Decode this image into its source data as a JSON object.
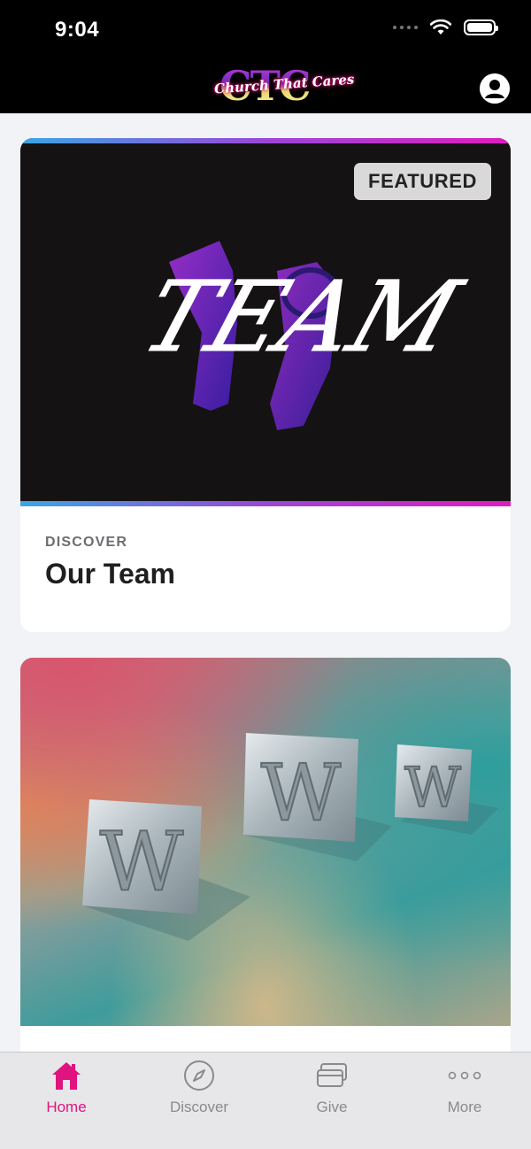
{
  "status_bar": {
    "time": "9:04"
  },
  "header": {
    "logo_text": "CTC",
    "logo_script": "Church That Cares"
  },
  "cards": [
    {
      "badge": "FEATURED",
      "hero_text": "TEAM",
      "eyebrow": "DISCOVER",
      "title": "Our Team"
    },
    {
      "hero_letters": [
        "W",
        "W",
        "W"
      ]
    }
  ],
  "tabs": [
    {
      "label": "Home",
      "icon": "home-icon",
      "active": true
    },
    {
      "label": "Discover",
      "icon": "compass-icon",
      "active": false
    },
    {
      "label": "Give",
      "icon": "card-icon",
      "active": false
    },
    {
      "label": "More",
      "icon": "more-icon",
      "active": false
    }
  ],
  "colors": {
    "accent": "#e0147e",
    "header_bg": "#000000",
    "tab_inactive": "#8a8a8e"
  }
}
